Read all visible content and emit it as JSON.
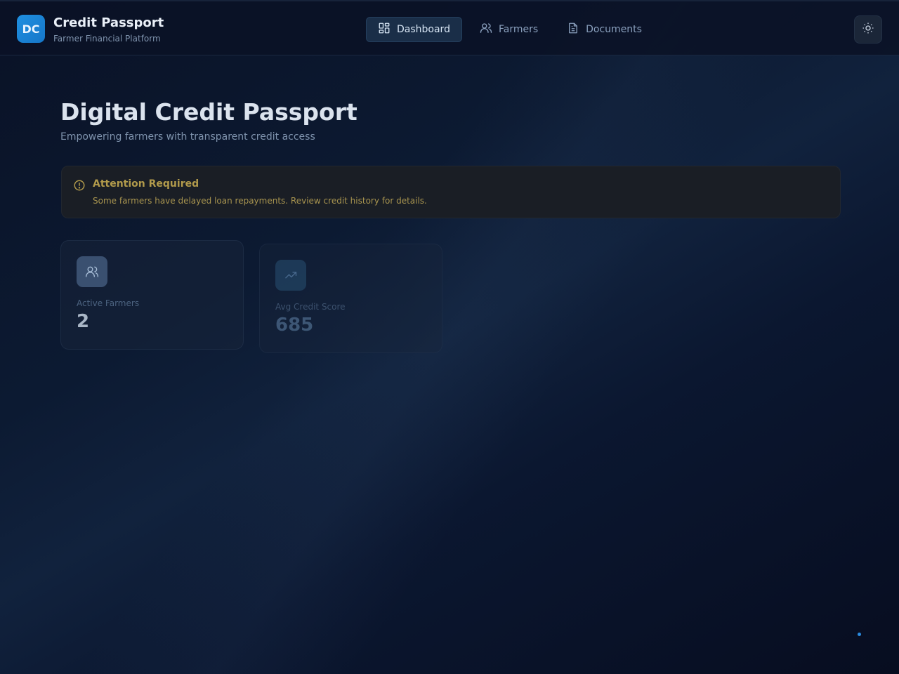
{
  "header": {
    "logo_initials": "DC",
    "title": "Credit Passport",
    "subtitle": "Farmer Financial Platform",
    "nav": [
      {
        "label": "Dashboard",
        "icon": "dashboard-grid-icon",
        "active": true
      },
      {
        "label": "Farmers",
        "icon": "users-icon",
        "active": false
      },
      {
        "label": "Documents",
        "icon": "document-icon",
        "active": false
      }
    ],
    "theme_toggle_icon": "sun-icon"
  },
  "main": {
    "title": "Digital Credit Passport",
    "subtitle": "Empowering farmers with transparent credit access",
    "alert": {
      "icon": "alert-circle-icon",
      "title": "Attention Required",
      "message": "Some farmers have delayed loan repayments. Review credit history for details.",
      "color": "#b19a4b"
    },
    "stats": [
      {
        "label": "Active Farmers",
        "value": "2",
        "icon": "users-icon"
      },
      {
        "label": "Avg Credit Score",
        "value": "685",
        "icon": "trending-up-icon"
      }
    ]
  },
  "colors": {
    "accent": "#1f8fe0",
    "background": "#0a1226",
    "warning": "#b19a4b"
  }
}
